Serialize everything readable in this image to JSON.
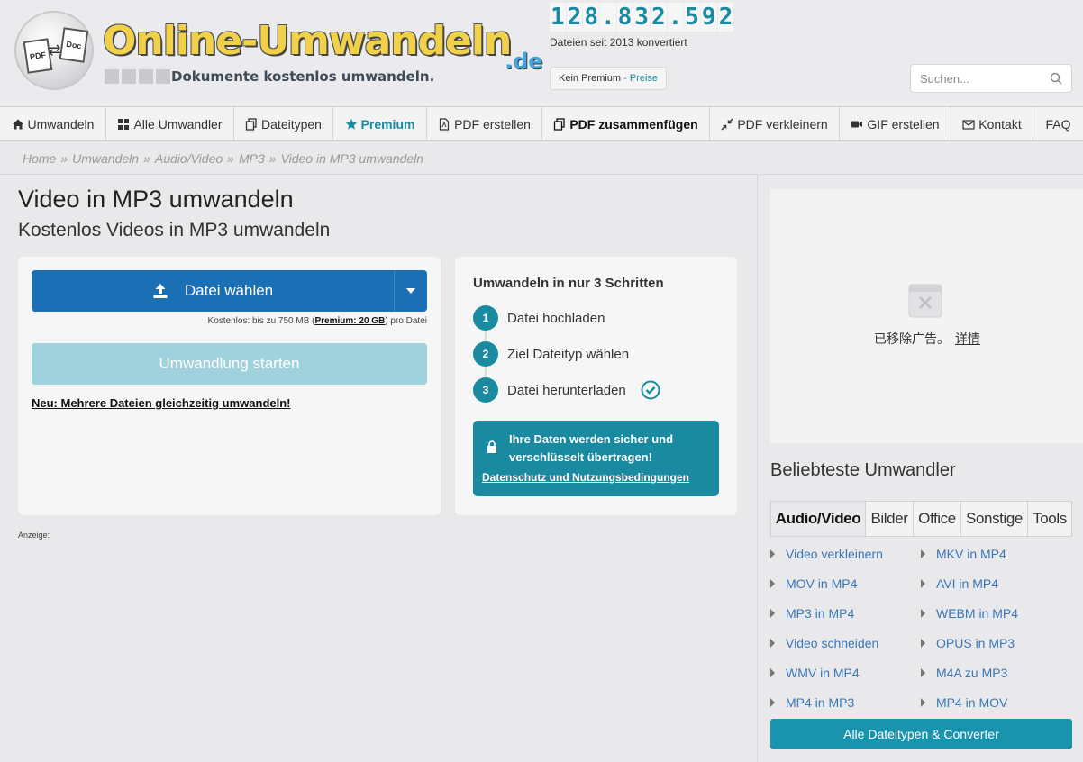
{
  "header": {
    "logo_text": "Online-Umwandeln",
    "logo_tld": ".de",
    "logo_tagline": "Dokumente kostenlos umwandeln.",
    "logo_doc_left": "PDF",
    "logo_doc_right": "Doc",
    "counter_digits": [
      "1",
      "2",
      "8",
      ".",
      "8",
      "3",
      "2",
      ".",
      "5",
      "9",
      "2"
    ],
    "counter_sub": "Dateien seit 2013 konvertiert",
    "premium_pill": "Kein Premium",
    "premium_dash": " - ",
    "premium_price": "Preise",
    "search_placeholder": "Suchen..."
  },
  "nav": [
    {
      "label": "Umwandeln",
      "icon": "home-icon"
    },
    {
      "label": "Alle Umwandler",
      "icon": "grid-icon"
    },
    {
      "label": "Dateitypen",
      "icon": "copy-icon"
    },
    {
      "label": "Premium",
      "icon": "star-icon"
    },
    {
      "label": "PDF erstellen",
      "icon": "file-pdf-icon"
    },
    {
      "label": "PDF zusammenfügen",
      "icon": "merge-icon"
    },
    {
      "label": "PDF verkleinern",
      "icon": "compress-icon"
    },
    {
      "label": "GIF erstellen",
      "icon": "video-camera-icon"
    },
    {
      "label": "Kontakt",
      "icon": "envelope-icon"
    },
    {
      "label": "FAQ",
      "icon": ""
    }
  ],
  "breadcrumb": [
    "Home",
    "Umwandeln",
    "Audio/Video",
    "MP3",
    "Video in MP3 umwandeln"
  ],
  "breadcrumb_sep": "»",
  "main": {
    "title": "Video in MP3 umwandeln",
    "subtitle": "Kostenlos Videos in MP3 umwandeln",
    "choose_file": "Datei wählen",
    "limit_prefix": "Kostenlos: bis zu 750 MB (",
    "limit_premium": "Premium: 20 GB",
    "limit_suffix": ") pro Datei",
    "start_button": "Umwandlung starten",
    "multi_link": "Neu: Mehrere Dateien gleichzeitig umwandeln!",
    "ad_label": "Anzeige:"
  },
  "steps": {
    "title": "Umwandeln in nur 3 Schritten",
    "items": [
      {
        "num": "1",
        "label": "Datei hochladen"
      },
      {
        "num": "2",
        "label": "Ziel Dateityp wählen"
      },
      {
        "num": "3",
        "label": "Datei herunterladen"
      }
    ],
    "secure_text": "Ihre Daten werden sicher und verschlüsselt übertragen!",
    "privacy_link": "Datenschutz und Nutzungsbedingungen"
  },
  "sidebar": {
    "ad_removed": "已移除广告。",
    "ad_details": "详情",
    "popular_title": "Beliebteste Umwandler",
    "tabs": [
      "Audio/Video",
      "Bilder",
      "Office",
      "Sonstige",
      "Tools"
    ],
    "active_tab": "Audio/Video",
    "converters_left": [
      "Video verkleinern",
      "MOV in MP4",
      "MP3 in MP4",
      "Video schneiden",
      "WMV in MP4",
      "MP4 in MP3"
    ],
    "converters_right": [
      "MKV in MP4",
      "AVI in MP4",
      "WEBM in MP4",
      "OPUS in MP3",
      "M4A zu MP3",
      "MP4 in MOV"
    ],
    "all_button": "Alle Dateitypen & Converter"
  },
  "colors": {
    "accent": "#1a8aa0",
    "primary_button": "#1a6fb5",
    "disabled_button": "#a0d2dd",
    "link": "#3a77b8",
    "logo_yellow": "#f1d04a"
  }
}
